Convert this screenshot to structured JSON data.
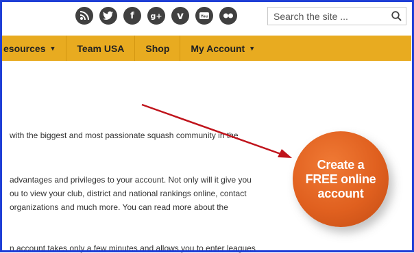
{
  "header": {
    "social_icons": [
      {
        "name": "rss-icon",
        "glyph": ""
      },
      {
        "name": "twitter-icon",
        "glyph": ""
      },
      {
        "name": "facebook-icon",
        "glyph": "f"
      },
      {
        "name": "google-plus-icon",
        "glyph": "g+"
      },
      {
        "name": "vimeo-icon",
        "glyph": "v"
      },
      {
        "name": "youtube-icon",
        "glyph": "You"
      },
      {
        "name": "flickr-icon",
        "glyph": ""
      }
    ],
    "search": {
      "placeholder": "Search the site ..."
    }
  },
  "nav": {
    "items": [
      {
        "label": "esources",
        "dropdown": true
      },
      {
        "label": "Team USA",
        "dropdown": false
      },
      {
        "label": "Shop",
        "dropdown": false
      },
      {
        "label": "My Account",
        "dropdown": true
      }
    ]
  },
  "content": {
    "para1": "with the biggest and most passionate squash community in the",
    "para2_lines": [
      "advantages and privileges to your account.  Not only will it give you",
      "ou to view your club, district and national rankings online, contact",
      "organizations and much more.  You can read more about the"
    ],
    "para3": "n account takes only a few minutes and allows you to enter leagues"
  },
  "cta": {
    "line1": "Create a",
    "line2": "FREE online",
    "line3": "account"
  },
  "colors": {
    "nav_bg": "#e8ab20",
    "cta_bg": "#e0601f",
    "arrow": "#c0141c",
    "frame": "#1f3fd6"
  }
}
